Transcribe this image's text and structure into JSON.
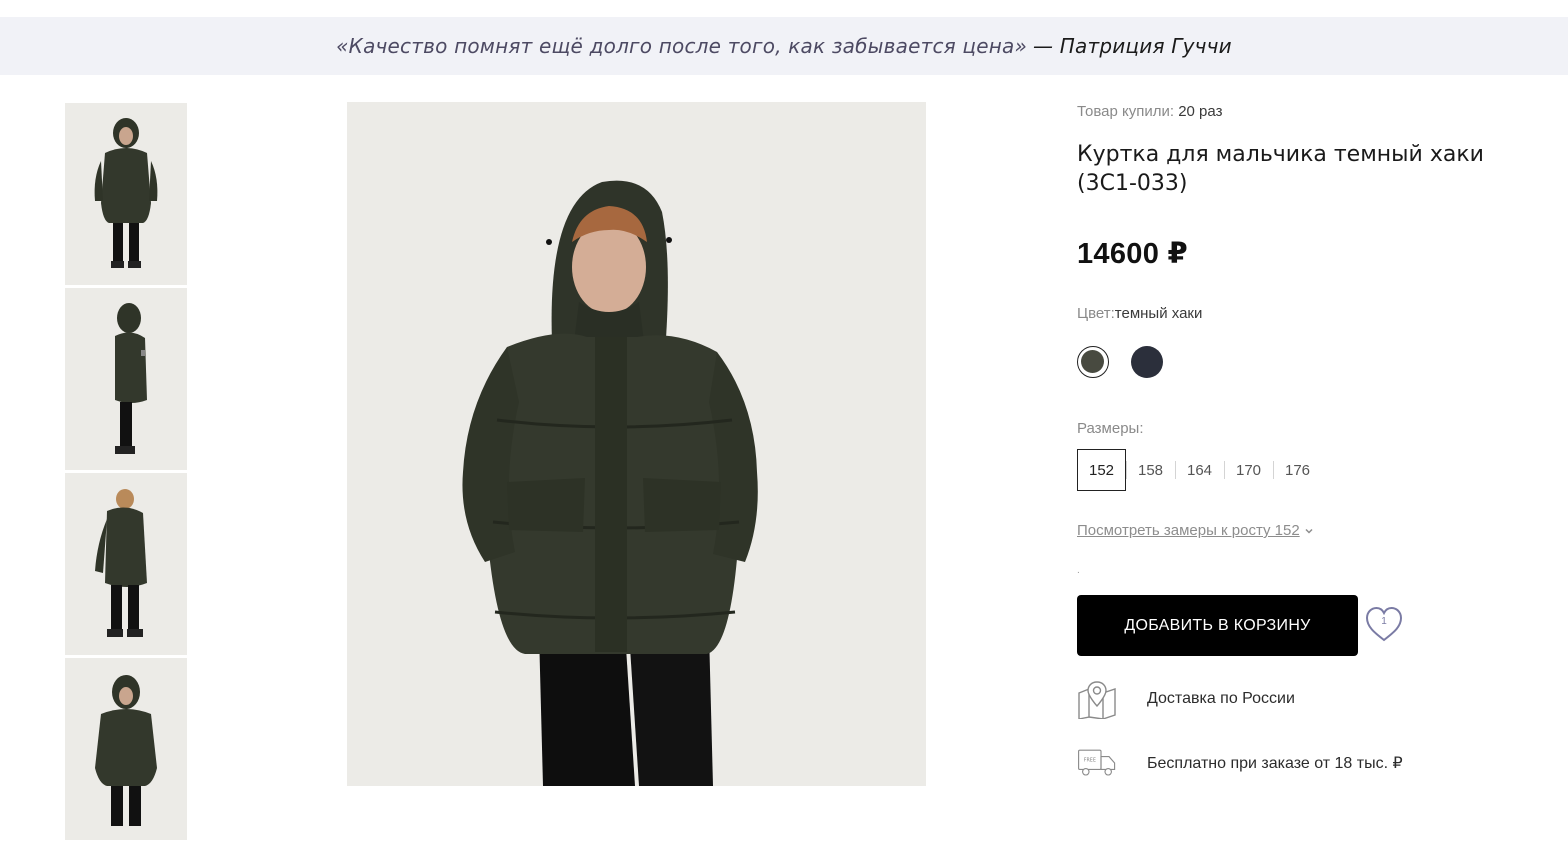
{
  "quote": {
    "text": "«Качество помнят ещё долго после того, как забывается цена»",
    "author": "— Патриция Гуччи"
  },
  "gallery": {
    "thumbnails": [
      "front-hood-up",
      "side-view",
      "back-view",
      "front-hood-up-closeup"
    ],
    "main_image": "front-hood-up"
  },
  "product": {
    "bought_label": "Товар купили:",
    "bought_count": "20 раз",
    "title": "Куртка для мальчика темный хаки (3С1-033)",
    "price": "14600 ₽",
    "color_label": "Цвет:",
    "color_value": "темный хаки",
    "colors": [
      {
        "name": "темный хаки",
        "hex": "#3d3f34",
        "selected": true
      },
      {
        "name": "темно-синий",
        "hex": "#2b2f3b",
        "selected": false
      }
    ],
    "sizes_label": "Размеры:",
    "sizes": [
      "152",
      "158",
      "164",
      "170",
      "176"
    ],
    "selected_size": "152",
    "measure_link": "Посмотреть замеры к росту 152",
    "dot": ".",
    "add_to_cart": "ДОБАВИТЬ В КОРЗИНУ",
    "favorites_count": "1"
  },
  "features": [
    {
      "icon": "map-pin-icon",
      "text": "Доставка по России"
    },
    {
      "icon": "free-delivery-truck-icon",
      "text": "Бесплатно при заказе от 18 тыс. ₽"
    }
  ],
  "colors": {
    "quote_bg": "#f1f2f7",
    "accent": "#7a7ba4",
    "button": "#000000",
    "jacket": "#33382c"
  }
}
